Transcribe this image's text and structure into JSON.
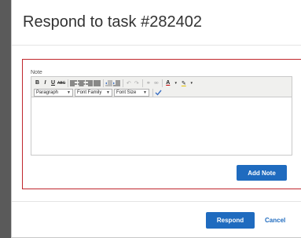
{
  "modal": {
    "title": "Respond to task #282402"
  },
  "note": {
    "label": "Note",
    "toolbar": {
      "bold": "B",
      "italic": "I",
      "underline": "U",
      "strikethrough": "ABC",
      "paragraph_select": "Paragraph",
      "font_family_select": "Font Family",
      "font_size_select": "Font Size"
    },
    "add_note_label": "Add Note"
  },
  "footer": {
    "respond_label": "Respond",
    "cancel_label": "Cancel"
  },
  "colors": {
    "primary": "#1f6bbf",
    "panel_border": "#c0262c"
  }
}
